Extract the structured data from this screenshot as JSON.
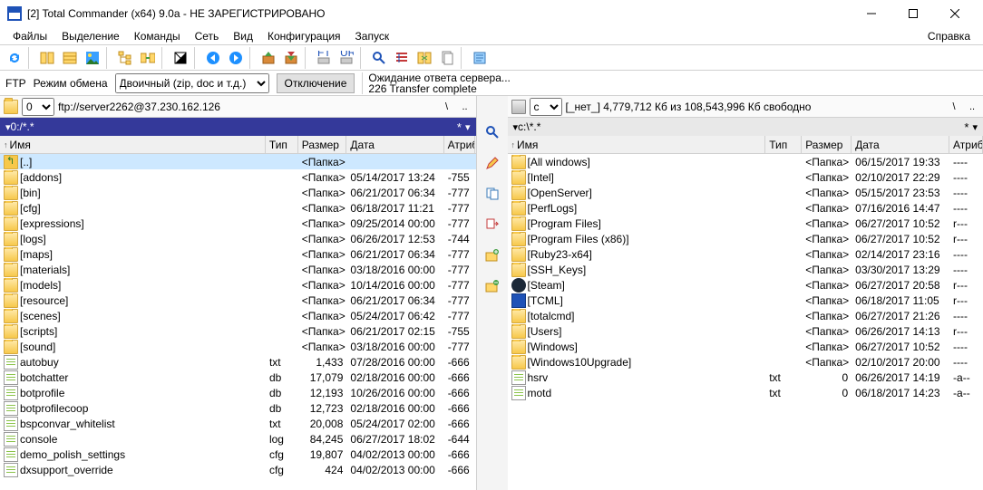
{
  "title": "[2] Total Commander (x64) 9.0a - НЕ ЗАРЕГИСТРИРОВАНО",
  "menu": {
    "file": "Файлы",
    "select": "Выделение",
    "commands": "Команды",
    "net": "Сеть",
    "view": "Вид",
    "config": "Конфигурация",
    "start": "Запуск",
    "help": "Справка"
  },
  "ftp": {
    "label": "FTP",
    "mode_label": "Режим обмена",
    "mode_value": "Двоичный (zip, doc и т.д.)",
    "disconnect": "Отключение",
    "status1": "Ожидание ответа сервера...",
    "status2": "226 Transfer complete"
  },
  "left": {
    "drive_label": "0",
    "addr": "ftp://server2262@37.230.162.126",
    "path": "0:/*.*",
    "hdr": {
      "name": "Имя",
      "ext": "Тип",
      "size": "Размер",
      "date": "Дата",
      "attr": "Атрибу"
    },
    "rows": [
      {
        "ico": "up",
        "name": "[..]",
        "ext": "",
        "size": "<Папка>",
        "date": "",
        "attr": "",
        "sel": true
      },
      {
        "ico": "folder",
        "name": "[addons]",
        "ext": "",
        "size": "<Папка>",
        "date": "05/14/2017 13:24",
        "attr": "-755"
      },
      {
        "ico": "folder",
        "name": "[bin]",
        "ext": "",
        "size": "<Папка>",
        "date": "06/21/2017 06:34",
        "attr": "-777"
      },
      {
        "ico": "folder",
        "name": "[cfg]",
        "ext": "",
        "size": "<Папка>",
        "date": "06/18/2017 11:21",
        "attr": "-777"
      },
      {
        "ico": "folder",
        "name": "[expressions]",
        "ext": "",
        "size": "<Папка>",
        "date": "09/25/2014 00:00",
        "attr": "-777"
      },
      {
        "ico": "folder",
        "name": "[logs]",
        "ext": "",
        "size": "<Папка>",
        "date": "06/26/2017 12:53",
        "attr": "-744"
      },
      {
        "ico": "folder",
        "name": "[maps]",
        "ext": "",
        "size": "<Папка>",
        "date": "06/21/2017 06:34",
        "attr": "-777"
      },
      {
        "ico": "folder",
        "name": "[materials]",
        "ext": "",
        "size": "<Папка>",
        "date": "03/18/2016 00:00",
        "attr": "-777"
      },
      {
        "ico": "folder",
        "name": "[models]",
        "ext": "",
        "size": "<Папка>",
        "date": "10/14/2016 00:00",
        "attr": "-777"
      },
      {
        "ico": "folder",
        "name": "[resource]",
        "ext": "",
        "size": "<Папка>",
        "date": "06/21/2017 06:34",
        "attr": "-777"
      },
      {
        "ico": "folder",
        "name": "[scenes]",
        "ext": "",
        "size": "<Папка>",
        "date": "05/24/2017 06:42",
        "attr": "-777"
      },
      {
        "ico": "folder",
        "name": "[scripts]",
        "ext": "",
        "size": "<Папка>",
        "date": "06/21/2017 02:15",
        "attr": "-755"
      },
      {
        "ico": "folder",
        "name": "[sound]",
        "ext": "",
        "size": "<Папка>",
        "date": "03/18/2016 00:00",
        "attr": "-777"
      },
      {
        "ico": "file",
        "name": "autobuy",
        "ext": "txt",
        "size": "1,433",
        "date": "07/28/2016 00:00",
        "attr": "-666"
      },
      {
        "ico": "file",
        "name": "botchatter",
        "ext": "db",
        "size": "17,079",
        "date": "02/18/2016 00:00",
        "attr": "-666"
      },
      {
        "ico": "file",
        "name": "botprofile",
        "ext": "db",
        "size": "12,193",
        "date": "10/26/2016 00:00",
        "attr": "-666"
      },
      {
        "ico": "file",
        "name": "botprofilecoop",
        "ext": "db",
        "size": "12,723",
        "date": "02/18/2016 00:00",
        "attr": "-666"
      },
      {
        "ico": "file",
        "name": "bspconvar_whitelist",
        "ext": "txt",
        "size": "20,008",
        "date": "05/24/2017 02:00",
        "attr": "-666"
      },
      {
        "ico": "file",
        "name": "console",
        "ext": "log",
        "size": "84,245",
        "date": "06/27/2017 18:02",
        "attr": "-644"
      },
      {
        "ico": "file",
        "name": "demo_polish_settings",
        "ext": "cfg",
        "size": "19,807",
        "date": "04/02/2013 00:00",
        "attr": "-666"
      },
      {
        "ico": "file",
        "name": "dxsupport_override",
        "ext": "cfg",
        "size": "424",
        "date": "04/02/2013 00:00",
        "attr": "-666"
      }
    ]
  },
  "right": {
    "drive_label": "c",
    "drive_info": "[_нет_]  4,779,712 Кб из 108,543,996 Кб свободно",
    "path": "c:\\*.*",
    "hdr": {
      "name": "Имя",
      "ext": "Тип",
      "size": "Размер",
      "date": "Дата",
      "attr": "Атрибу"
    },
    "rows": [
      {
        "ico": "folder",
        "name": "[All windows]",
        "ext": "",
        "size": "<Папка>",
        "date": "06/15/2017 19:33",
        "attr": "----"
      },
      {
        "ico": "folder",
        "name": "[Intel]",
        "ext": "",
        "size": "<Папка>",
        "date": "02/10/2017 22:29",
        "attr": "----"
      },
      {
        "ico": "folder",
        "name": "[OpenServer]",
        "ext": "",
        "size": "<Папка>",
        "date": "05/15/2017 23:53",
        "attr": "----"
      },
      {
        "ico": "folder",
        "name": "[PerfLogs]",
        "ext": "",
        "size": "<Папка>",
        "date": "07/16/2016 14:47",
        "attr": "----"
      },
      {
        "ico": "folder",
        "name": "[Program Files]",
        "ext": "",
        "size": "<Папка>",
        "date": "06/27/2017 10:52",
        "attr": "r---"
      },
      {
        "ico": "folder",
        "name": "[Program Files (x86)]",
        "ext": "",
        "size": "<Папка>",
        "date": "06/27/2017 10:52",
        "attr": "r---"
      },
      {
        "ico": "folder",
        "name": "[Ruby23-x64]",
        "ext": "",
        "size": "<Папка>",
        "date": "02/14/2017 23:16",
        "attr": "----"
      },
      {
        "ico": "folder",
        "name": "[SSH_Keys]",
        "ext": "",
        "size": "<Папка>",
        "date": "03/30/2017 13:29",
        "attr": "----"
      },
      {
        "ico": "steam",
        "name": "[Steam]",
        "ext": "",
        "size": "<Папка>",
        "date": "06/27/2017 20:58",
        "attr": "r---"
      },
      {
        "ico": "disk",
        "name": "[TCML]",
        "ext": "",
        "size": "<Папка>",
        "date": "06/18/2017 11:05",
        "attr": "r---"
      },
      {
        "ico": "folder",
        "name": "[totalcmd]",
        "ext": "",
        "size": "<Папка>",
        "date": "06/27/2017 21:26",
        "attr": "----"
      },
      {
        "ico": "folder",
        "name": "[Users]",
        "ext": "",
        "size": "<Папка>",
        "date": "06/26/2017 14:13",
        "attr": "r---"
      },
      {
        "ico": "folder",
        "name": "[Windows]",
        "ext": "",
        "size": "<Папка>",
        "date": "06/27/2017 10:52",
        "attr": "----"
      },
      {
        "ico": "folder",
        "name": "[Windows10Upgrade]",
        "ext": "",
        "size": "<Папка>",
        "date": "02/10/2017 20:00",
        "attr": "----"
      },
      {
        "ico": "file",
        "name": "hsrv",
        "ext": "txt",
        "size": "0",
        "date": "06/26/2017 14:19",
        "attr": "-a--"
      },
      {
        "ico": "file",
        "name": "motd",
        "ext": "txt",
        "size": "0",
        "date": "06/18/2017 14:23",
        "attr": "-a--"
      }
    ]
  }
}
